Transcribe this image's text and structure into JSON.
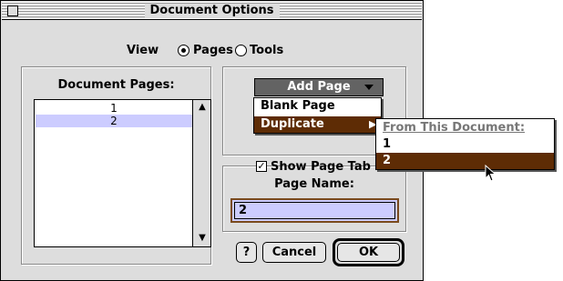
{
  "window": {
    "title": "Document Options"
  },
  "view": {
    "label": "View",
    "options": [
      {
        "label": "Pages",
        "selected": true
      },
      {
        "label": "Tools",
        "selected": false
      }
    ]
  },
  "pages": {
    "label": "Document Pages:",
    "items": [
      "1",
      "2"
    ],
    "selected_index": 1
  },
  "add_page": {
    "label": "Add Page",
    "menu": [
      "Blank Page",
      "Duplicate"
    ],
    "submenu": {
      "header": "From This Document:",
      "items": [
        "1",
        "2"
      ],
      "selected_index": 1
    }
  },
  "show_page_tab": {
    "label": "Show Page Tab",
    "checked": true
  },
  "page_name": {
    "label": "Page Name:",
    "value": "2"
  },
  "buttons": {
    "help": "?",
    "cancel": "Cancel",
    "ok": "OK"
  },
  "colors": {
    "menu_highlight": "#5e2c05",
    "list_highlight": "#ccccff",
    "popup_button": "#636363"
  }
}
